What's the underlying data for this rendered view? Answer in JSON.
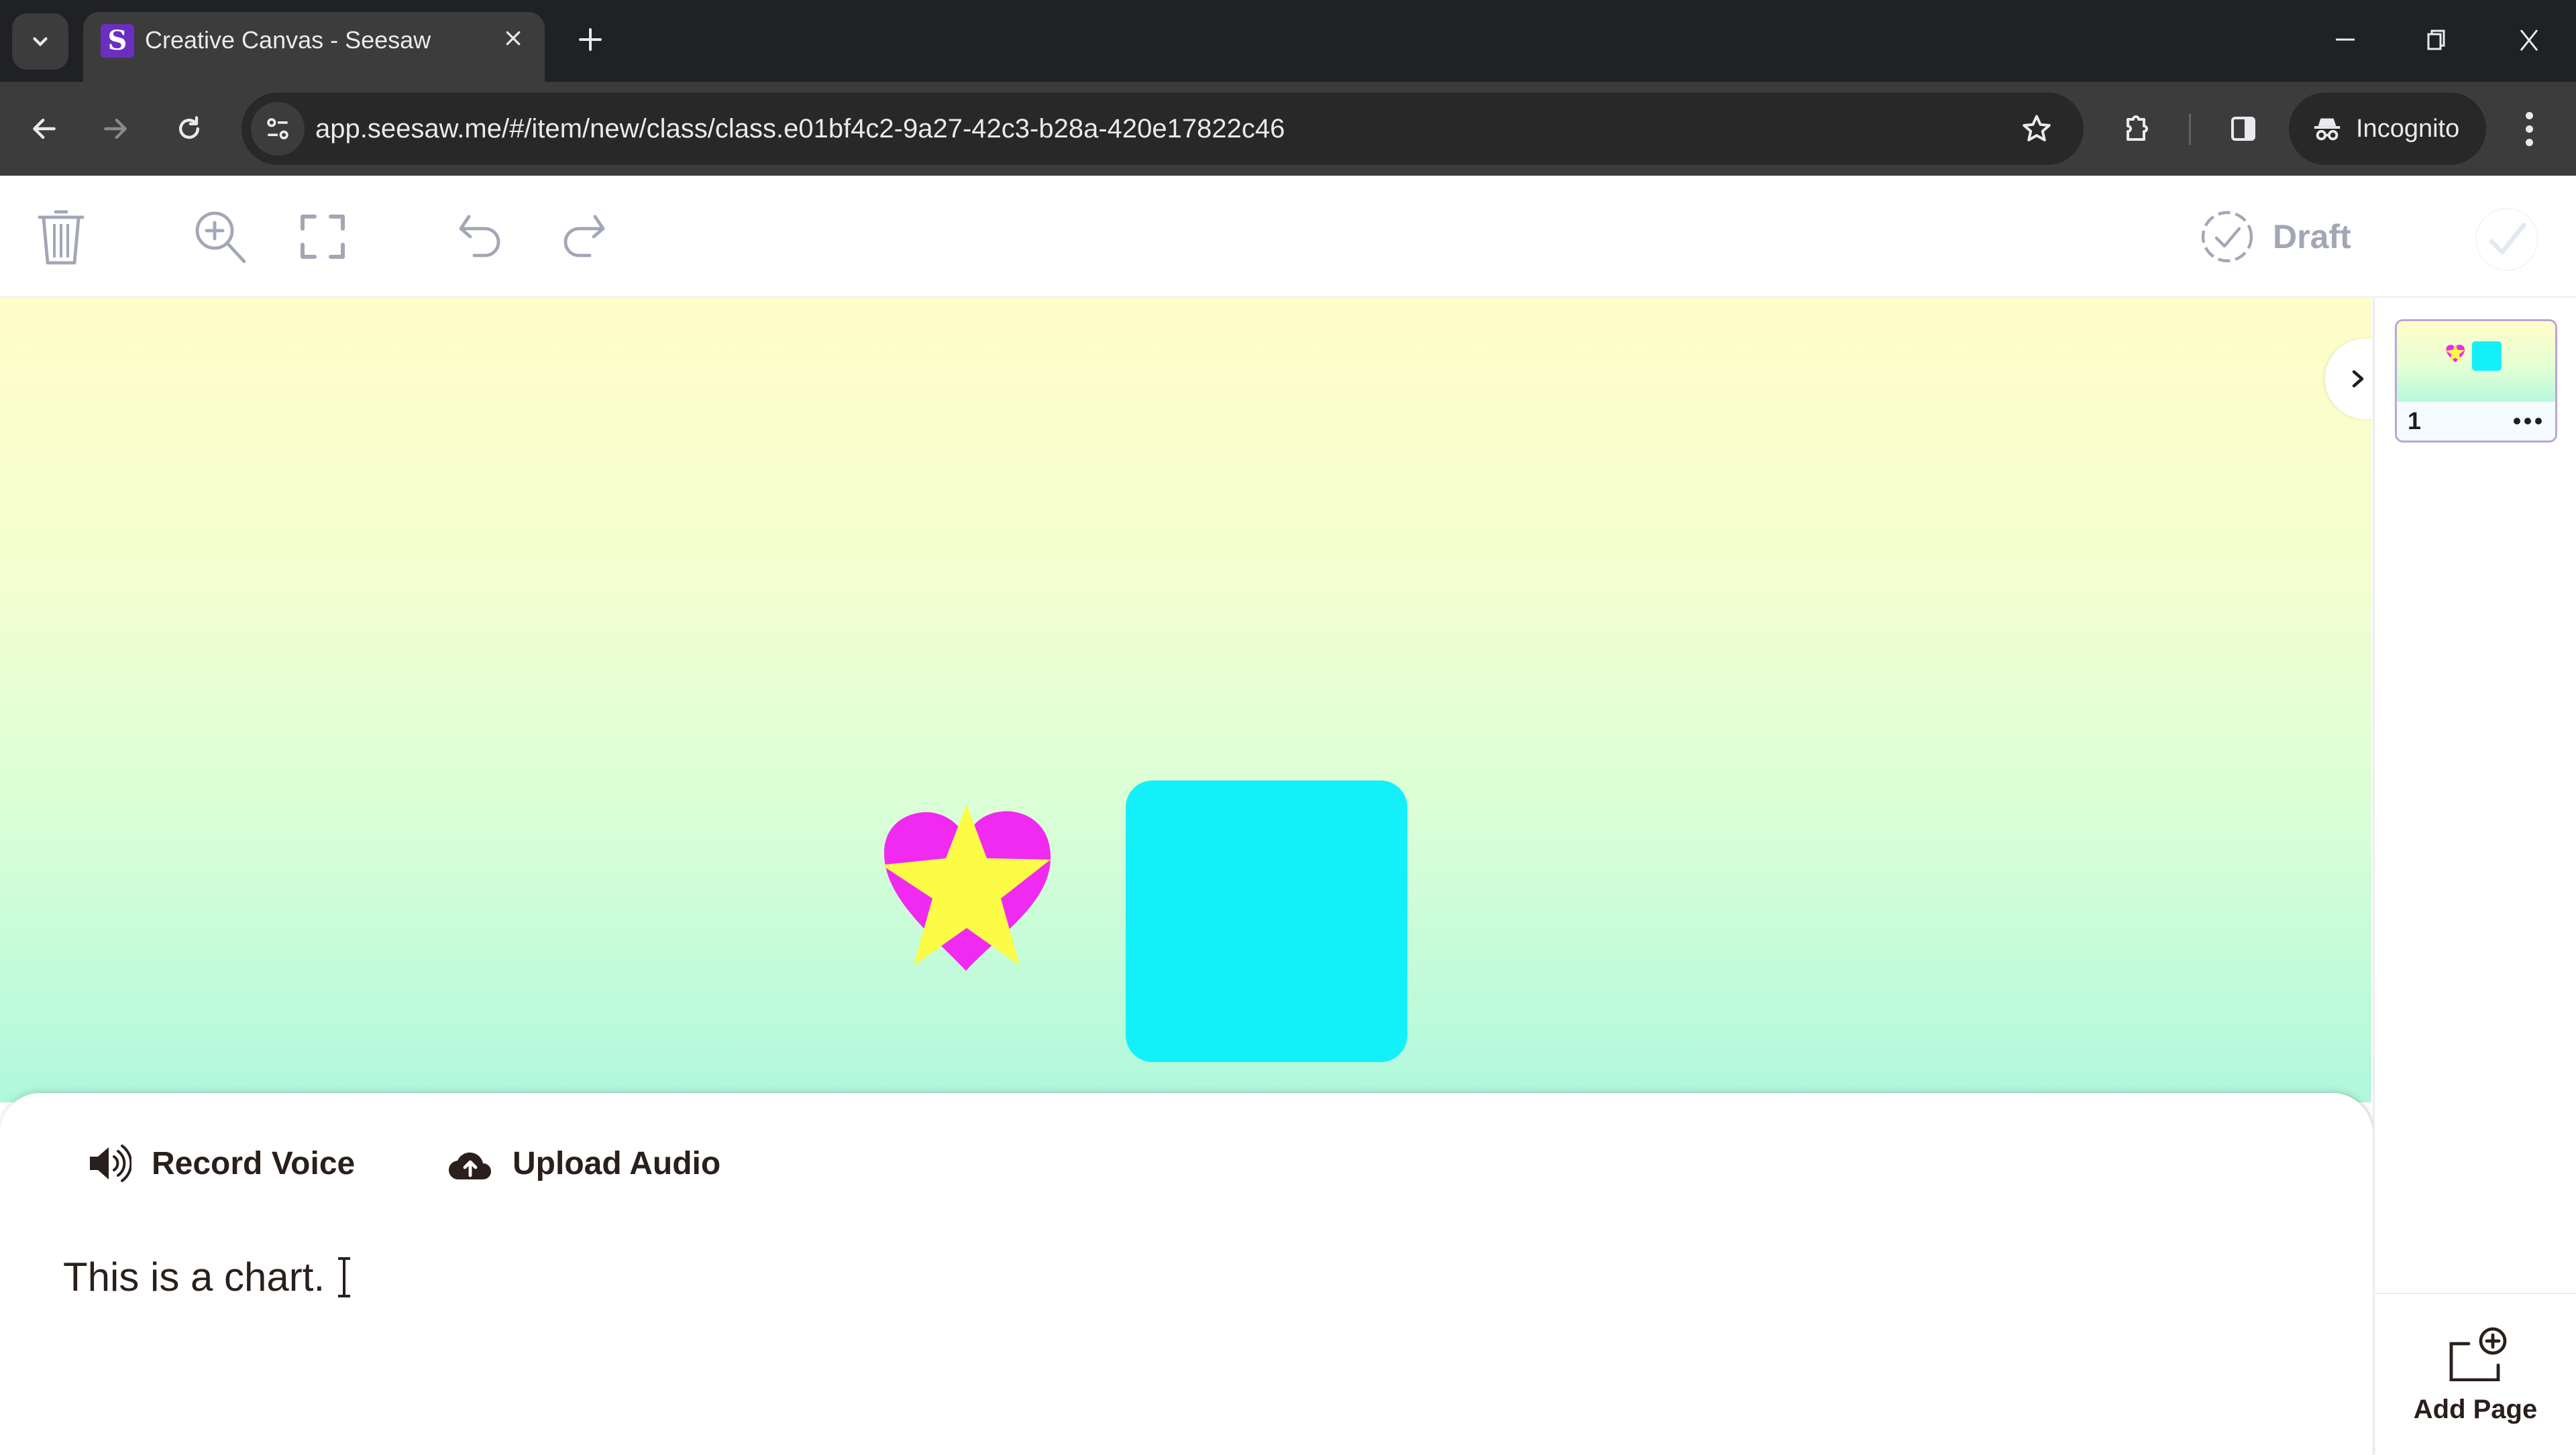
{
  "browser": {
    "tab_title": "Creative Canvas - Seesaw",
    "favicon_letter": "S",
    "url": "app.seesaw.me/#/item/new/class/class.e01bf4c2-9a27-42c3-b28a-420e17822c46",
    "incognito_label": "Incognito",
    "tab_close_glyph": "✕",
    "new_tab_glyph": "+"
  },
  "app_toolbar": {
    "draft_label": "Draft"
  },
  "canvas": {
    "background_gradient": [
      "#fffdc9",
      "#f3ffd0",
      "#d9ffd7",
      "#aff8dc"
    ],
    "objects": [
      {
        "type": "heart",
        "color": "#f02af0"
      },
      {
        "type": "star",
        "color": "#fcfc47"
      },
      {
        "type": "rounded-square",
        "color": "#14f0fa"
      }
    ]
  },
  "caption_panel": {
    "record_voice_label": "Record Voice",
    "upload_audio_label": "Upload Audio",
    "caption_text": "This is a chart."
  },
  "sidebar": {
    "pages": [
      {
        "number": "1"
      }
    ],
    "add_page_label": "Add Page"
  },
  "colors": {
    "chrome_dark": "#202124",
    "chrome_toolbar": "#3c3c3c",
    "favicon": "#6a2fc1",
    "icon_gray": "#a3a6b5",
    "text_dark": "#2a1f1c",
    "thumb_border": "#b8a6d8"
  }
}
